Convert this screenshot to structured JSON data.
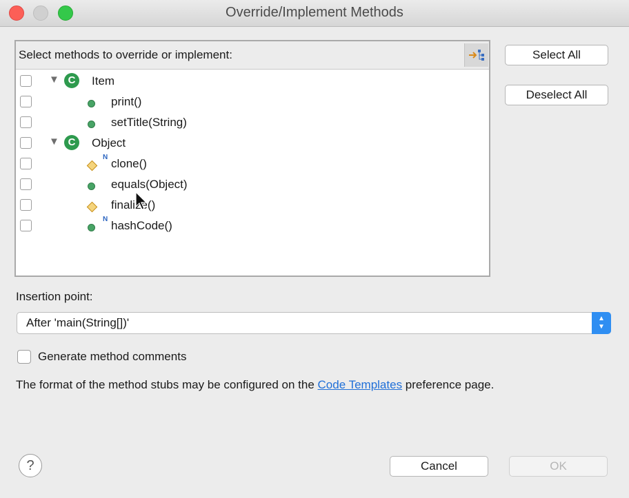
{
  "window": {
    "title": "Override/Implement Methods"
  },
  "tree": {
    "header": "Select methods to override or implement:",
    "rows": [
      {
        "kind": "class",
        "label": "Item"
      },
      {
        "kind": "method",
        "label": "print()",
        "icon": "public-method-icon"
      },
      {
        "kind": "method",
        "label": "setTitle(String)",
        "icon": "public-method-icon"
      },
      {
        "kind": "class",
        "label": "Object"
      },
      {
        "kind": "method",
        "label": "clone()",
        "icon": "protected-method-icon",
        "native": true
      },
      {
        "kind": "method",
        "label": "equals(Object)",
        "icon": "public-method-icon"
      },
      {
        "kind": "method",
        "label": "finalize()",
        "icon": "protected-method-icon"
      },
      {
        "kind": "method",
        "label": "hashCode()",
        "icon": "public-method-icon",
        "native": true
      }
    ],
    "native_marker": "N",
    "class_icon_letter": "C"
  },
  "buttons": {
    "select_all": "Select All",
    "deselect_all": "Deselect All",
    "cancel": "Cancel",
    "ok": "OK"
  },
  "insertion": {
    "label": "Insertion point:",
    "value": "After 'main(String[])'"
  },
  "generate_comments": {
    "label": "Generate method comments",
    "checked": false
  },
  "info": {
    "before": "The format of the method stubs may be configured on the ",
    "link": "Code Templates",
    "after": " preference page."
  },
  "help": {
    "glyph": "?"
  },
  "colors": {
    "accent": "#2f8ef2",
    "close": "#fc5f57",
    "maximize": "#34c84a",
    "link": "#1f6fd8"
  }
}
